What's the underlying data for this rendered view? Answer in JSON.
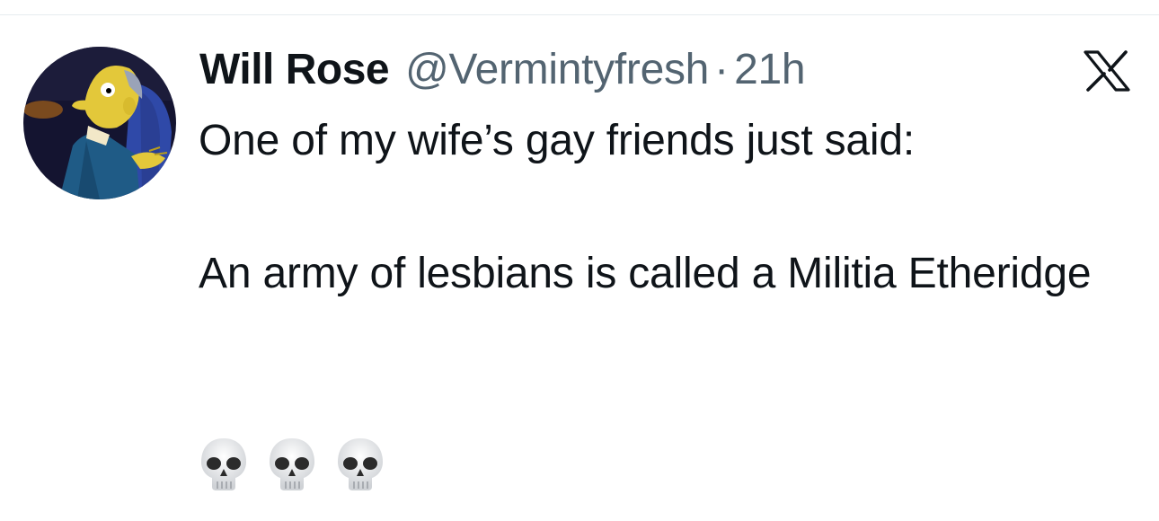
{
  "tweet": {
    "author_name": "Will Rose",
    "handle": "@Vermintyfresh",
    "separator": "·",
    "time": "21h",
    "text_line1": "One of my wife’s gay friends just said:",
    "text_para2": "An army of lesbians is called a Militia Etheridge",
    "emojis": [
      "skull-emoji",
      "skull-emoji",
      "skull-emoji"
    ]
  },
  "icons": {
    "brand_logo": "x-logo-icon"
  },
  "colors": {
    "text_primary": "#0f1419",
    "text_secondary": "#536471",
    "divider": "#e6ecf0",
    "avatar_bg": "#1a1a40"
  }
}
